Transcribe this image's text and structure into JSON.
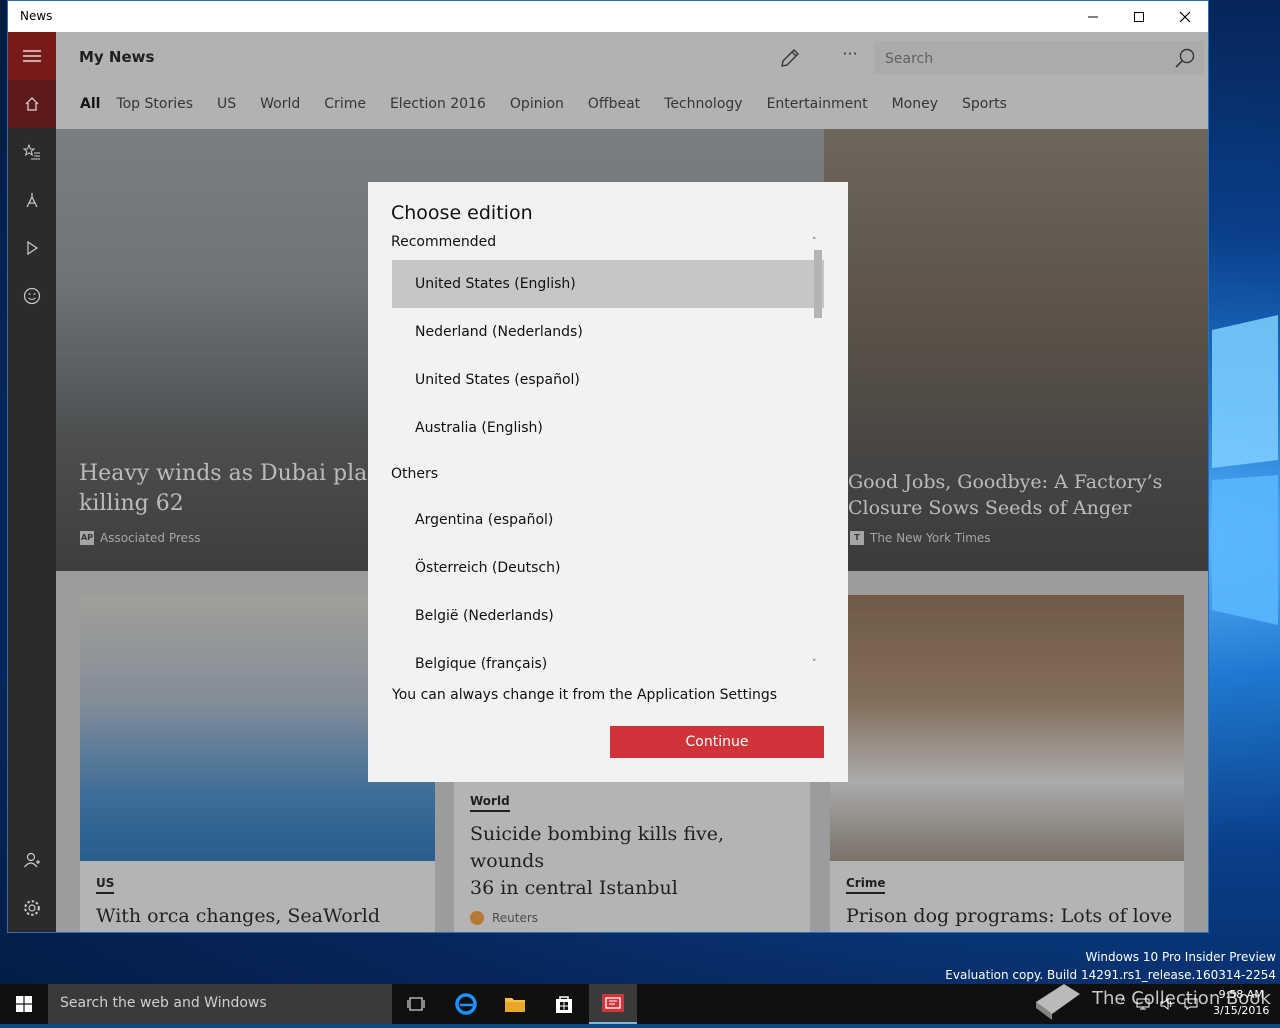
{
  "window": {
    "title": "News"
  },
  "app": {
    "page_title": "My News",
    "search_placeholder": "Search",
    "more_label": "···",
    "tabs": [
      "All",
      "Top Stories",
      "US",
      "World",
      "Crime",
      "Election 2016",
      "Opinion",
      "Offbeat",
      "Technology",
      "Entertainment",
      "Money",
      "Sports"
    ]
  },
  "articles": {
    "hero1": {
      "headline_line1": "Heavy winds as Dubai plane",
      "headline_line2": "killing 62",
      "source": "Associated Press",
      "badge": "AP"
    },
    "hero2": {
      "headline_line1": "Good Jobs, Goodbye: A Factory’s",
      "headline_line2": "Closure Sows Seeds of Anger",
      "source": "The New York Times",
      "badge": "T"
    },
    "tile1": {
      "category": "US",
      "headline": "With orca changes, SeaWorld must"
    },
    "tile2": {
      "category": "World",
      "headline_line1": "Suicide bombing kills five, wounds",
      "headline_line2": "36 in central Istanbul",
      "source": "Reuters"
    },
    "tile3": {
      "category": "Crime",
      "headline": "Prison dog programs: Lots of love"
    }
  },
  "dialog": {
    "title": "Choose edition",
    "recommended_label": "Recommended",
    "recommended": [
      "United States (English)",
      "Nederland (Nederlands)",
      "United States (español)",
      "Australia (English)"
    ],
    "others_label": "Others",
    "others": [
      "Argentina (español)",
      "Österreich (Deutsch)",
      "België (Nederlands)",
      "Belgique (français)"
    ],
    "selected": "United States (English)",
    "note": "You can always change it from the Application Settings",
    "continue_label": "Continue"
  },
  "watermark": {
    "line1": "Windows 10 Pro Insider Preview",
    "line2": "Evaluation copy. Build 14291.rs1_release.160314-2254",
    "brand": "The Collection Book"
  },
  "taskbar": {
    "search_placeholder": "Search the web and Windows",
    "time": "9:58 AM",
    "date": "3/15/2016"
  },
  "colors": {
    "accent": "#d13438",
    "rail": "#2b2b2b",
    "rail_active": "#7a1b1b"
  }
}
